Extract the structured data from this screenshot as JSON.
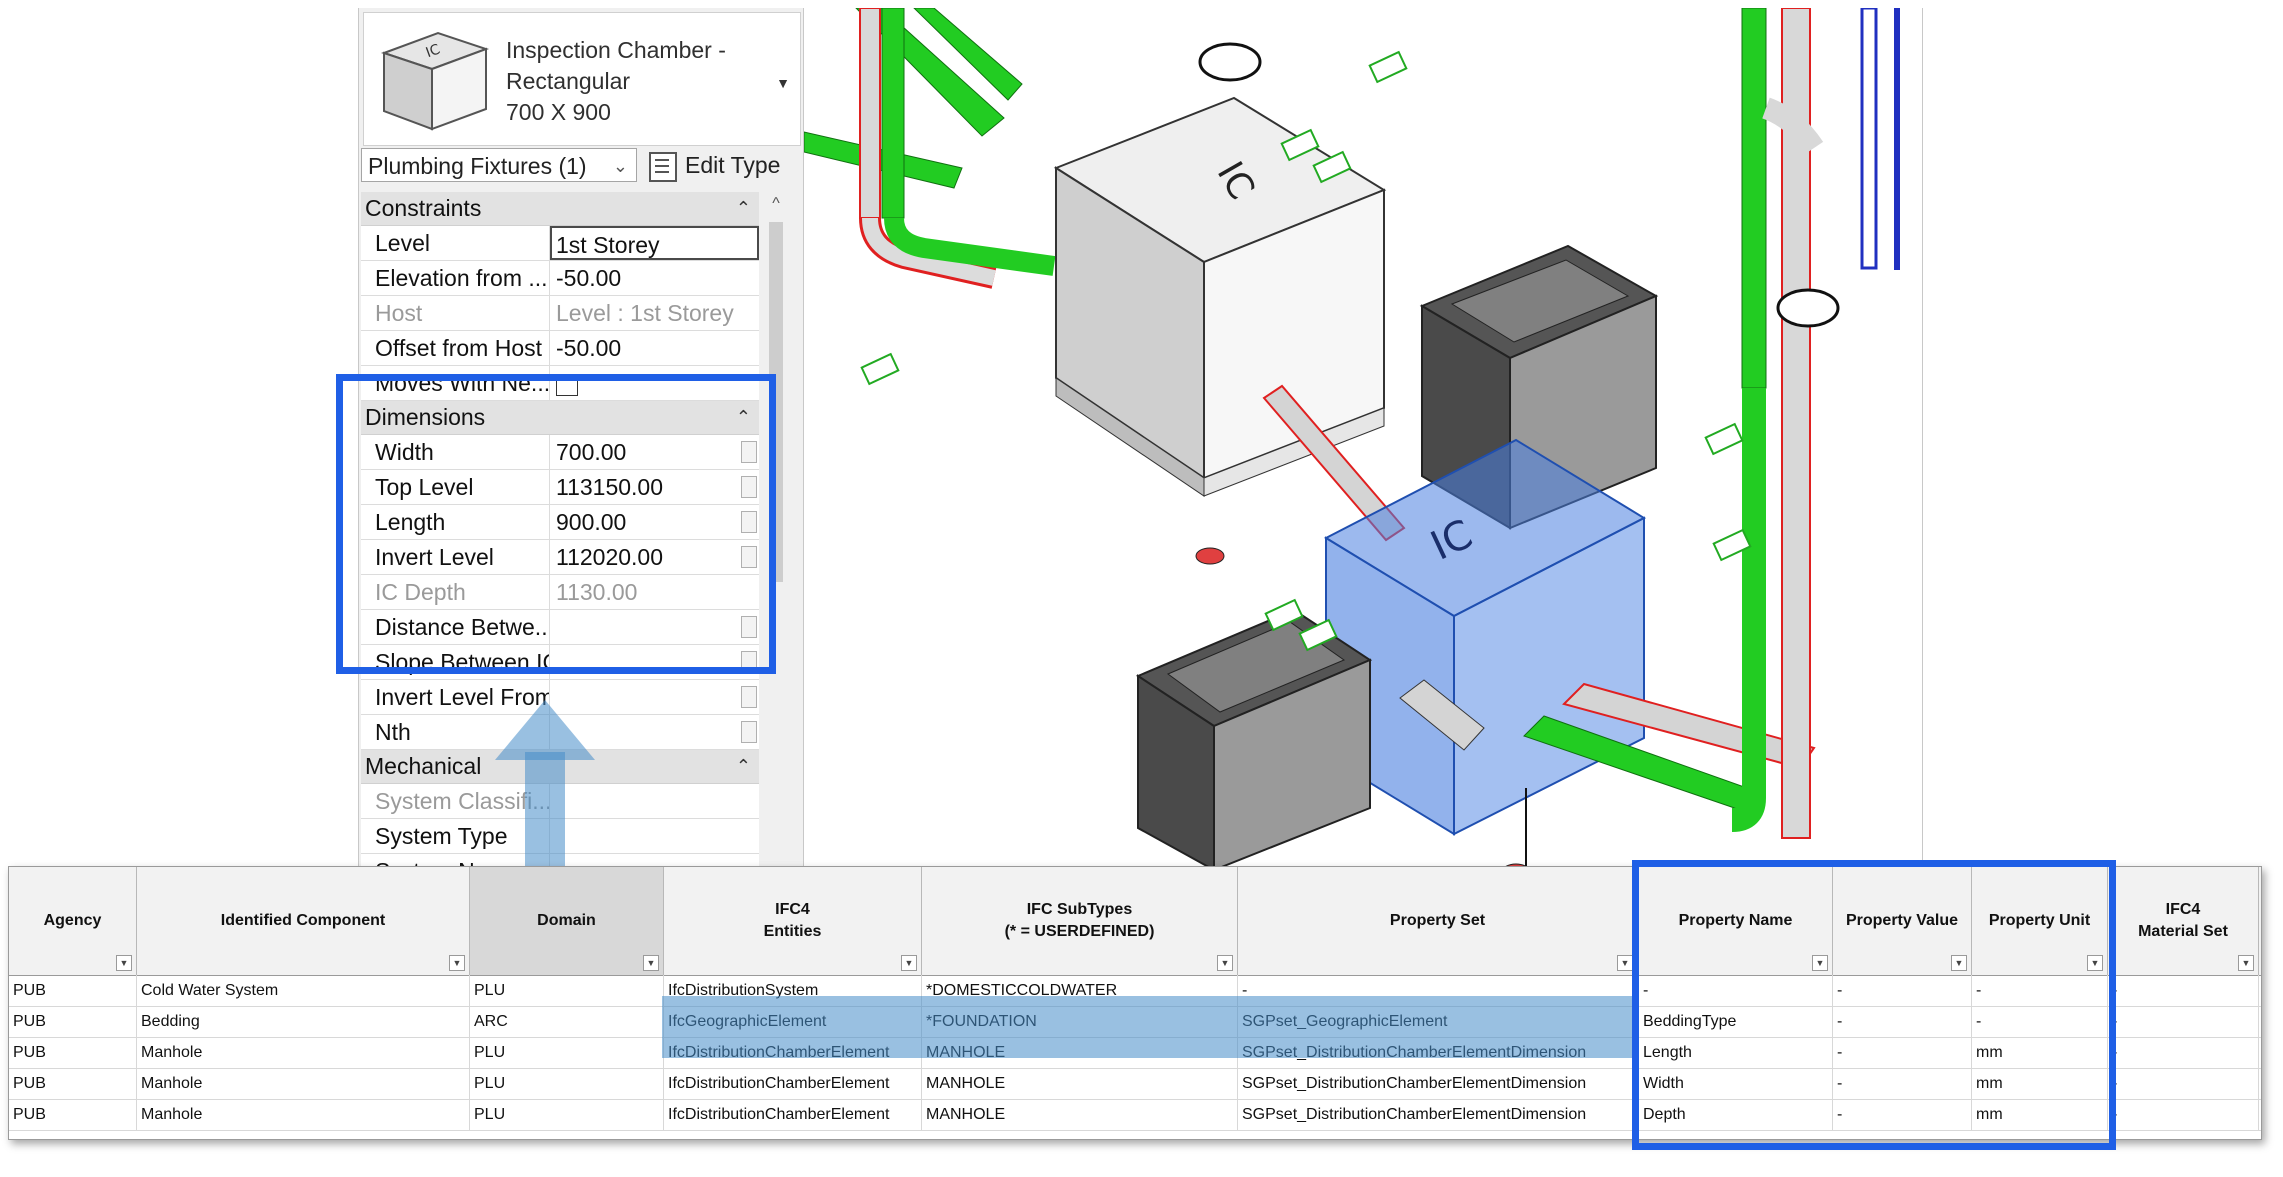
{
  "properties": {
    "type_name": "Inspection Chamber -\nRectangular\n700 X 900",
    "category_selector": "Plumbing Fixtures (1)",
    "edit_type_label": "Edit Type",
    "sections": [
      {
        "title": "Constraints",
        "rows": [
          {
            "label": "Level",
            "value": "1st Storey",
            "state": "edit"
          },
          {
            "label": "Elevation from ...",
            "value": "-50.00",
            "state": "normal"
          },
          {
            "label": "Host",
            "value": "Level : 1st Storey",
            "state": "dim"
          },
          {
            "label": "Offset from Host",
            "value": "-50.00",
            "state": "normal"
          },
          {
            "label": "Moves With Ne...",
            "value": "",
            "state": "checkbox"
          }
        ]
      },
      {
        "title": "Dimensions",
        "rows": [
          {
            "label": "Width",
            "value": "700.00",
            "state": "btn"
          },
          {
            "label": "Top Level",
            "value": "113150.00",
            "state": "btn"
          },
          {
            "label": "Length",
            "value": "900.00",
            "state": "btn"
          },
          {
            "label": "Invert Level",
            "value": "112020.00",
            "state": "btn"
          },
          {
            "label": "IC Depth",
            "value": "1130.00",
            "state": "dim"
          },
          {
            "label": "Distance Betwe...",
            "value": "",
            "state": "btn"
          },
          {
            "label": "Slope Between IC",
            "value": "",
            "state": "btn"
          },
          {
            "label": "Invert Level From",
            "value": "",
            "state": "btn"
          },
          {
            "label": "Nth",
            "value": "",
            "state": "btn"
          }
        ]
      },
      {
        "title": "Mechanical",
        "rows": [
          {
            "label": "System Classifi...",
            "value": "",
            "state": "dim"
          },
          {
            "label": "System Type",
            "value": "",
            "state": "normal"
          },
          {
            "label": "System Name",
            "value": "",
            "state": "normal"
          }
        ]
      }
    ]
  },
  "table": {
    "headers": [
      "Agency",
      "Identified Component",
      "Domain",
      "IFC4\nEntities",
      "IFC SubTypes\n(* = USERDEFINED)",
      "Property Set",
      "Property Name",
      "Property Value",
      "Property Unit",
      "IFC4\nMaterial Set"
    ],
    "rows": [
      [
        "PUB",
        "Cold Water System",
        "PLU",
        "IfcDistributionSystem",
        "*DOMESTICCOLDWATER",
        "-",
        "-",
        "-",
        "-",
        "-"
      ],
      [
        "PUB",
        "Bedding",
        "ARC",
        "IfcGeographicElement",
        "*FOUNDATION",
        "SGPset_GeographicElement",
        "BeddingType",
        "-",
        "-",
        "-"
      ],
      [
        "PUB",
        "Manhole",
        "PLU",
        "IfcDistributionChamberElement",
        "MANHOLE",
        "SGPset_DistributionChamberElementDimension",
        "Length",
        "-",
        "mm",
        "-"
      ],
      [
        "PUB",
        "Manhole",
        "PLU",
        "IfcDistributionChamberElement",
        "MANHOLE",
        "SGPset_DistributionChamberElementDimension",
        "Width",
        "-",
        "mm",
        "-"
      ],
      [
        "PUB",
        "Manhole",
        "PLU",
        "IfcDistributionChamberElement",
        "MANHOLE",
        "SGPset_DistributionChamberElementDimension",
        "Depth",
        "-",
        "mm",
        "-"
      ]
    ]
  },
  "colors": {
    "highlight": "#1f5fe6",
    "selection": "#4a7fe0",
    "pipe_green": "#22cc22",
    "pipe_red": "#e02020"
  },
  "icons": [
    "inspection-chamber-thumbnail",
    "edit-type-icon",
    "collapse-chevron-icon",
    "filter-icon",
    "curved-arrow"
  ]
}
